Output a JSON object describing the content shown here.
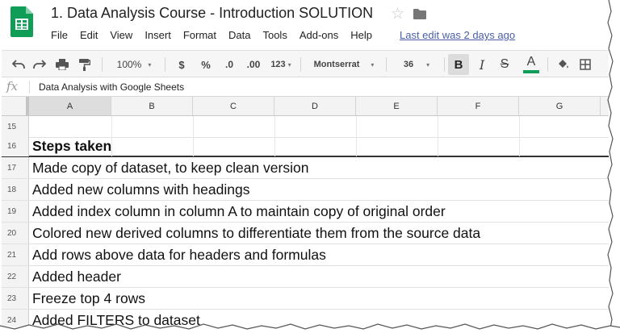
{
  "app": {
    "doc_title": "1. Data Analysis Course - Introduction SOLUTION",
    "last_edit": "Last edit was 2 days ago"
  },
  "menu": [
    "File",
    "Edit",
    "View",
    "Insert",
    "Format",
    "Data",
    "Tools",
    "Add-ons",
    "Help"
  ],
  "toolbar": {
    "zoom": "100%",
    "currency": "$",
    "percent": "%",
    "decrease_decimal": ".0",
    "increase_decimal": ".00",
    "more_formats": "123",
    "font": "Montserrat",
    "font_size": "36",
    "bold": "B",
    "italic": "I",
    "strike": "S",
    "text_color": "A",
    "text_color_bar": "#0f9d58"
  },
  "formula_bar": {
    "fx": "fx",
    "value": "Data Analysis with Google Sheets"
  },
  "columns": [
    "A",
    "B",
    "C",
    "D",
    "E",
    "F",
    "G"
  ],
  "rows": [
    {
      "num": "15",
      "text": ""
    },
    {
      "num": "16",
      "text": "Steps taken"
    },
    {
      "num": "17",
      "text": "Made copy of dataset, to keep clean version"
    },
    {
      "num": "18",
      "text": "Added new columns with headings"
    },
    {
      "num": "19",
      "text": "Added index column in column A to maintain copy of original order"
    },
    {
      "num": "20",
      "text": "Colored new derived columns to differentiate them from the source data"
    },
    {
      "num": "21",
      "text": "Add rows above data for headers and formulas"
    },
    {
      "num": "22",
      "text": "Added header"
    },
    {
      "num": "23",
      "text": "Freeze top 4 rows"
    },
    {
      "num": "24",
      "text": "Added FILTERS to dataset"
    }
  ],
  "colors": {
    "sheets_green": "#0f9d58",
    "link": "#4a5ea5"
  }
}
